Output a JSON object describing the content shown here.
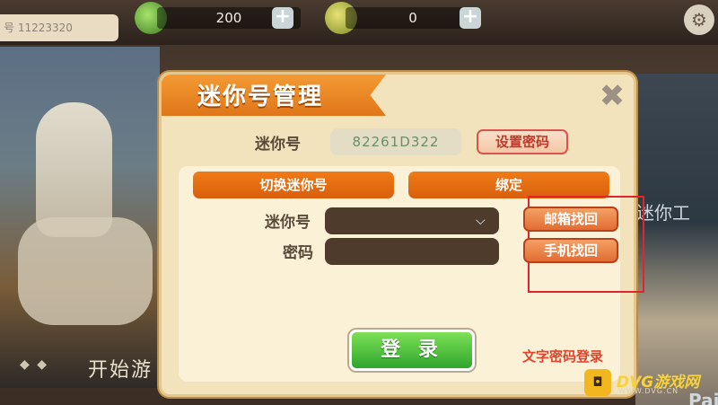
{
  "top_bar": {
    "player_id": "号 11223320",
    "gems": "200",
    "coins": "0",
    "plus": "+",
    "settings_icon": "⚙"
  },
  "background": {
    "start_label": "开始游",
    "page_dots": "◆ ◆",
    "right_text": "迷你工",
    "right_text_2": "Pai"
  },
  "dialog": {
    "title": "迷你号管理",
    "close": "✖",
    "mini_id_label": "迷你号",
    "mini_id_value": "82261D322",
    "set_password": "设置密码",
    "tabs": {
      "switch": "切换迷你号",
      "bind": "绑定"
    },
    "account_label": "迷你号",
    "password_label": "密码",
    "account_value": "",
    "password_value": "",
    "email_recover": "邮箱找回",
    "phone_recover": "手机找回",
    "login": "登 录",
    "text_password_login": "文字密码登录"
  },
  "watermark": {
    "logo": "◘",
    "text": "DVG游戏网",
    "sub": "WWW.DVG.CN"
  },
  "colors": {
    "accent_orange": "#e0761a",
    "login_green": "#2ea52c",
    "highlight_red": "#e0262a"
  }
}
